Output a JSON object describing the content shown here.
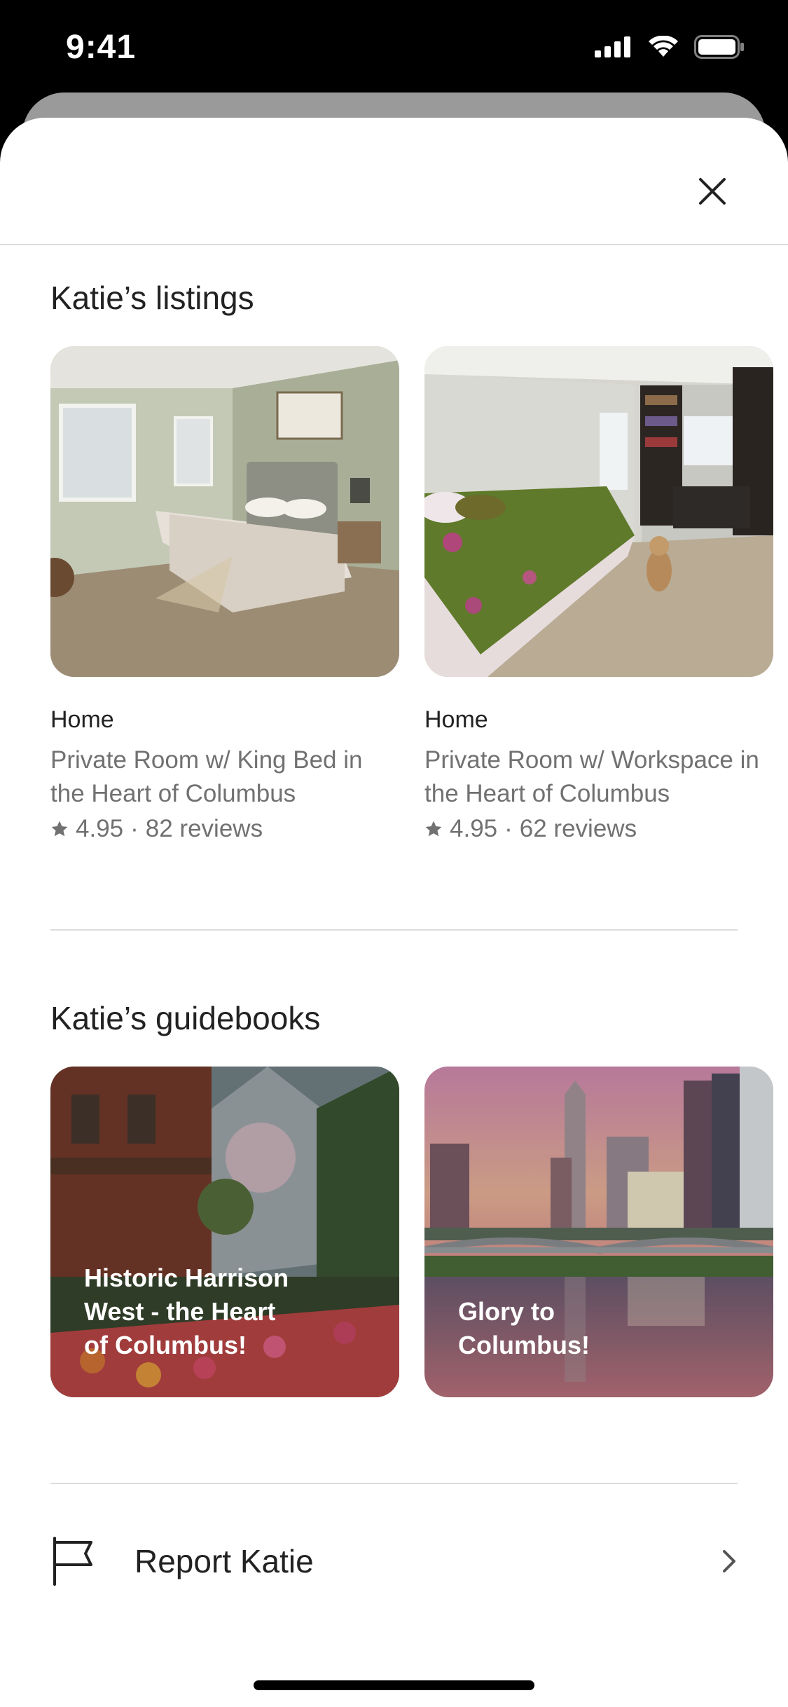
{
  "status_bar": {
    "time": "9:41"
  },
  "listings": {
    "title": "Katie’s listings",
    "items": [
      {
        "type": "Home",
        "title": "Private Room w/ King Bed in the Heart of Columbus",
        "rating": "4.95",
        "separator": "·",
        "reviews": "82 reviews"
      },
      {
        "type": "Home",
        "title": "Private Room w/ Workspace in the Heart of Columbus",
        "rating": "4.95",
        "separator": "·",
        "reviews": "62 reviews"
      }
    ]
  },
  "guidebooks": {
    "title": "Katie’s guidebooks",
    "items": [
      {
        "label": "Historic Harrison West - the Heart of Columbus!"
      },
      {
        "label": "Glory to Columbus!"
      }
    ]
  },
  "report": {
    "label": "Report Katie"
  },
  "icons": {
    "close": "close-icon",
    "flag": "flag-icon",
    "chevron": "chevron-right-icon",
    "star": "star-icon"
  },
  "colors": {
    "text_primary": "#222222",
    "text_secondary": "#717171",
    "divider": "#dddddd"
  }
}
